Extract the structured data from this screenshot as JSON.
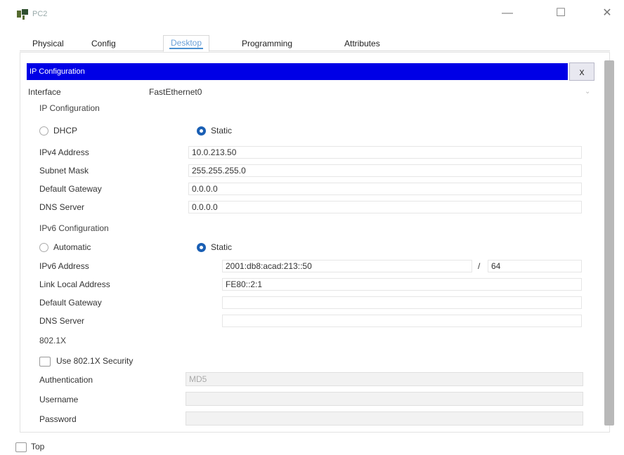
{
  "window": {
    "title": "PC2",
    "minimize": "—",
    "maximize": "☐",
    "close": "✕"
  },
  "tabs": [
    {
      "label": "Physical"
    },
    {
      "label": "Config"
    },
    {
      "label": "Desktop"
    },
    {
      "label": "Programming"
    },
    {
      "label": "Attributes"
    }
  ],
  "active_tab": "Desktop",
  "panel": {
    "title": "IP Configuration",
    "close": "x"
  },
  "interface": {
    "label": "Interface",
    "value": "FastEthernet0"
  },
  "ipv4": {
    "section": "IP Configuration",
    "dhcp_label": "DHCP",
    "static_label": "Static",
    "mode": "Static",
    "address_label": "IPv4 Address",
    "address": "10.0.213.50",
    "mask_label": "Subnet Mask",
    "mask": "255.255.255.0",
    "gateway_label": "Default Gateway",
    "gateway": "0.0.0.0",
    "dns_label": "DNS Server",
    "dns": "0.0.0.0"
  },
  "ipv6": {
    "section": "IPv6 Configuration",
    "auto_label": "Automatic",
    "static_label": "Static",
    "mode": "Static",
    "address_label": "IPv6 Address",
    "address": "2001:db8:acad:213::50",
    "prefix_sep": "/",
    "prefix": "64",
    "link_local_label": "Link Local Address",
    "link_local": "FE80::2:1",
    "gateway_label": "Default Gateway",
    "gateway": "",
    "dns_label": "DNS Server",
    "dns": ""
  },
  "dot1x": {
    "section": "802.1X",
    "use_label": "Use 802.1X Security",
    "use_checked": false,
    "auth_label": "Authentication",
    "auth_value": "MD5",
    "username_label": "Username",
    "username": "",
    "password_label": "Password",
    "password": ""
  },
  "footer": {
    "top_label": "Top",
    "top_checked": false
  }
}
